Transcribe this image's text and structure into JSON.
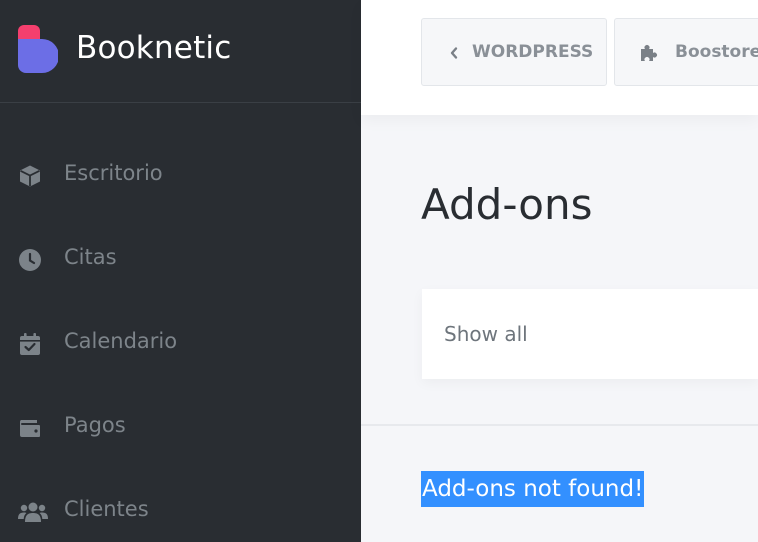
{
  "sidebar": {
    "brand": "Booknetic",
    "items": [
      {
        "label": "Escritorio",
        "icon": "cube-icon"
      },
      {
        "label": "Citas",
        "icon": "clock-icon"
      },
      {
        "label": "Calendario",
        "icon": "calendar-check-icon"
      },
      {
        "label": "Pagos",
        "icon": "wallet-icon"
      },
      {
        "label": "Clientes",
        "icon": "users-icon"
      }
    ]
  },
  "topbar": {
    "back_label": "WORDPRESS",
    "boostore_label": "Boostore"
  },
  "main": {
    "title": "Add-ons",
    "filter_label": "Show all",
    "empty_message": "Add-ons not found!"
  },
  "colors": {
    "sidebar_bg": "#292d32",
    "logo_pink": "#f43f6e",
    "logo_purple": "#6c6ee6",
    "selection": "#3390ff"
  }
}
